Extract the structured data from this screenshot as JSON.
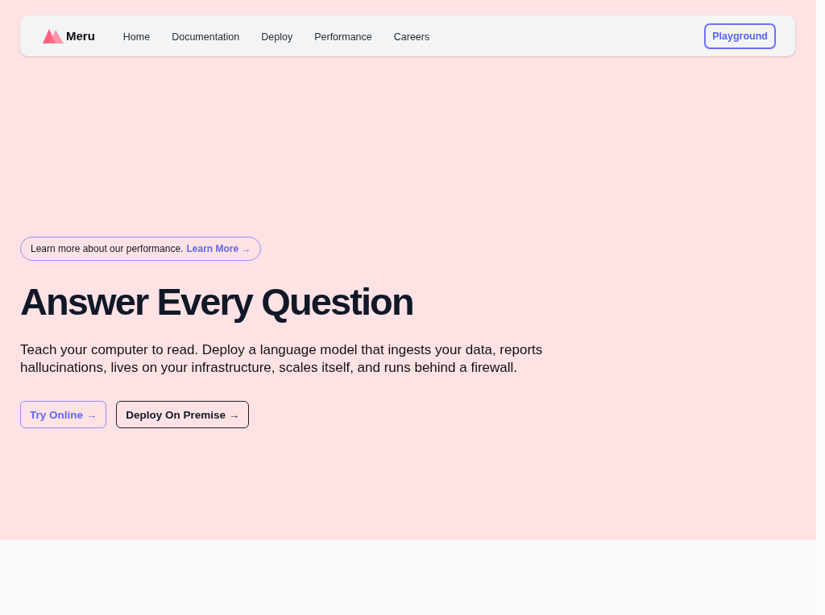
{
  "navbar": {
    "brand": "Meru",
    "links": [
      {
        "label": "Home"
      },
      {
        "label": "Documentation"
      },
      {
        "label": "Deploy"
      },
      {
        "label": "Performance"
      },
      {
        "label": "Careers"
      }
    ],
    "cta": "Playground"
  },
  "hero": {
    "announcement": {
      "text": "Learn more about our performance.",
      "link": "Learn More →"
    },
    "title": "Answer Every Question",
    "description": "Teach your computer to read. Deploy a language model that ingests your data, reports hallucinations, lives on your infrastructure, scales itself, and runs behind a firewall.",
    "buttons": [
      {
        "label": "Try Online →",
        "kind": "primary"
      },
      {
        "label": "Deploy On Premise →",
        "kind": "secondary"
      }
    ]
  }
}
